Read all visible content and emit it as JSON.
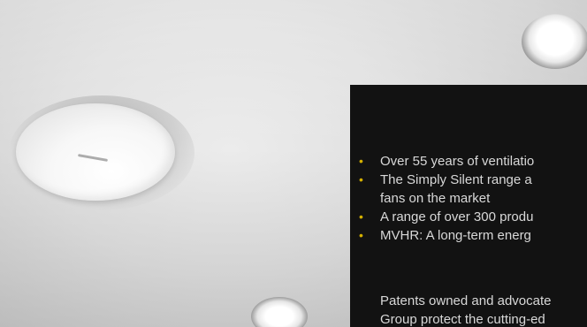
{
  "panel": {
    "bullets": [
      {
        "line1": "Over 55 years of ventilatio",
        "line2": ""
      },
      {
        "line1": "The Simply Silent range a",
        "line2": "fans on the market"
      },
      {
        "line1": "A range of over 300 produ",
        "line2": ""
      },
      {
        "line1": "MVHR: A long-term energ",
        "line2": ""
      }
    ],
    "bullet_marker": "•",
    "paragraph": {
      "line1": "Patents owned and advocate",
      "line2": "Group protect the cutting-ed"
    }
  },
  "colors": {
    "panel_bg": "#121212",
    "panel_text": "#d8d8d8",
    "bullet_accent": "#d4b000"
  },
  "icons": {
    "ceiling_fan": "extractor-fan-icon",
    "downlight": "downlight-icon"
  }
}
